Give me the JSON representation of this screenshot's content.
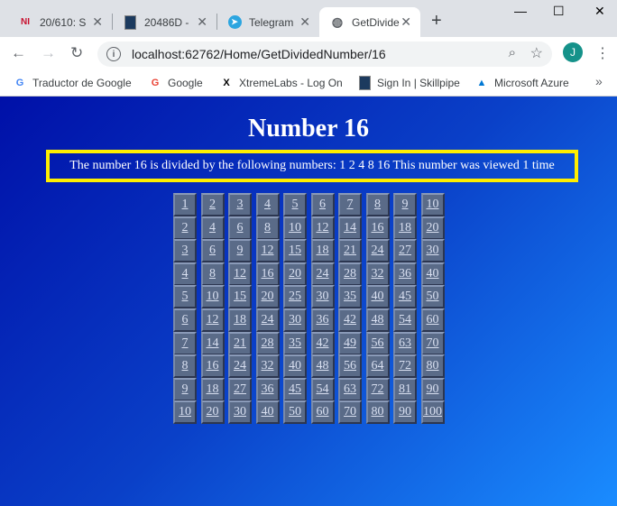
{
  "tabs": [
    {
      "icon": "NI",
      "title": "20/610: S",
      "active": false
    },
    {
      "icon": "doc",
      "title": "20486D -",
      "active": false
    },
    {
      "icon": "telegram",
      "title": "Telegram",
      "active": false
    },
    {
      "icon": "globe",
      "title": "GetDivide",
      "active": true
    }
  ],
  "new_tab": "+",
  "window": {
    "minimize": "—",
    "maximize": "☐",
    "close": "✕"
  },
  "toolbar": {
    "back": "←",
    "forward": "→",
    "reload": "↻",
    "url": "localhost:62762/Home/GetDividedNumber/16",
    "avatar": "J",
    "menu": "⋮"
  },
  "bookmarks": [
    {
      "icon": "translate-icon",
      "label": "Traductor de Google"
    },
    {
      "icon": "google-icon",
      "label": "Google"
    },
    {
      "icon": "xtremelabs-icon",
      "label": "XtremeLabs - Log On"
    },
    {
      "icon": "skillpipe-icon",
      "label": "Sign In | Skillpipe"
    },
    {
      "icon": "azure-icon",
      "label": "Microsoft Azure"
    }
  ],
  "bookmarks_more": "»",
  "page": {
    "title": "Number 16",
    "info": "The number 16 is divided by the following numbers: 1 2 4 8 16 This number was viewed 1 time"
  },
  "grid": [
    [
      1,
      2,
      3,
      4,
      5,
      6,
      7,
      8,
      9,
      10
    ],
    [
      2,
      4,
      6,
      8,
      10,
      12,
      14,
      16,
      18,
      20
    ],
    [
      3,
      6,
      9,
      12,
      15,
      18,
      21,
      24,
      27,
      30
    ],
    [
      4,
      8,
      12,
      16,
      20,
      24,
      28,
      32,
      36,
      40
    ],
    [
      5,
      10,
      15,
      20,
      25,
      30,
      35,
      40,
      45,
      50
    ],
    [
      6,
      12,
      18,
      24,
      30,
      36,
      42,
      48,
      54,
      60
    ],
    [
      7,
      14,
      21,
      28,
      35,
      42,
      49,
      56,
      63,
      70
    ],
    [
      8,
      16,
      24,
      32,
      40,
      48,
      56,
      64,
      72,
      80
    ],
    [
      9,
      18,
      27,
      36,
      45,
      54,
      63,
      72,
      81,
      90
    ],
    [
      10,
      20,
      30,
      40,
      50,
      60,
      70,
      80,
      90,
      100
    ]
  ]
}
